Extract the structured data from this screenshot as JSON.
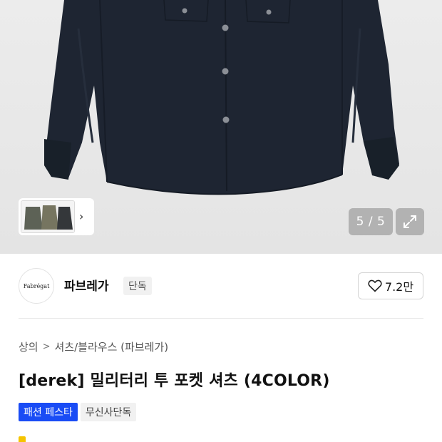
{
  "gallery": {
    "counter": "5 / 5",
    "thumbnail_colors": [
      "#5d6256",
      "#767560",
      "#34373a"
    ]
  },
  "brand": {
    "logo_text": "Fabrégat",
    "name": "파브레가",
    "badge": "단독"
  },
  "likes": {
    "count": "7.2만",
    "icon": "heart-outline-icon"
  },
  "breadcrumb": {
    "items": [
      "상의",
      "셔츠/블라우스 (파브레가)"
    ],
    "separator": ">"
  },
  "product": {
    "title": "[derek] 밀리터리 투 포켓 셔츠 (4COLOR)"
  },
  "tags": {
    "festa": "패션 페스타",
    "exclusive": "무신사단독"
  },
  "colors": {
    "accent": "#1a4cf5",
    "shirt": "#1d2430",
    "hero_bg": "#e9e9e9"
  }
}
